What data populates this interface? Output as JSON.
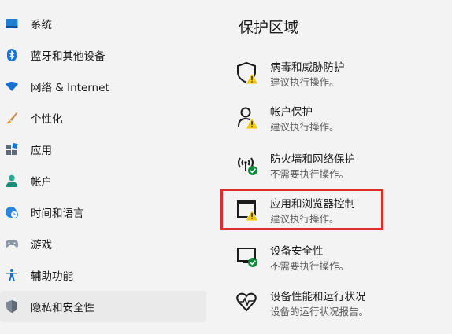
{
  "sidebar": {
    "items": [
      {
        "label": "系统",
        "icon": "system-icon"
      },
      {
        "label": "蓝牙和其他设备",
        "icon": "bluetooth-icon"
      },
      {
        "label": "网络 & Internet",
        "icon": "wifi-icon"
      },
      {
        "label": "个性化",
        "icon": "brush-icon"
      },
      {
        "label": "应用",
        "icon": "apps-icon"
      },
      {
        "label": "帐户",
        "icon": "account-icon"
      },
      {
        "label": "时间和语言",
        "icon": "globe-clock-icon"
      },
      {
        "label": "游戏",
        "icon": "gamepad-icon"
      },
      {
        "label": "辅助功能",
        "icon": "accessibility-icon"
      },
      {
        "label": "隐私和安全性",
        "icon": "shield-icon",
        "selected": true
      }
    ]
  },
  "main": {
    "title": "保护区域",
    "areas": [
      {
        "title": "病毒和威胁防护",
        "status": "建议执行操作。",
        "icon": "virus-protection-icon",
        "state": "warning"
      },
      {
        "title": "帐户保护",
        "status": "建议执行操作。",
        "icon": "account-protection-icon",
        "state": "warning"
      },
      {
        "title": "防火墙和网络保护",
        "status": "不需要执行操作。",
        "icon": "firewall-icon",
        "state": "ok"
      },
      {
        "title": "应用和浏览器控制",
        "status": "建议执行操作。",
        "icon": "app-browser-control-icon",
        "state": "warning"
      },
      {
        "title": "设备安全性",
        "status": "不需要执行操作。",
        "icon": "device-security-icon",
        "state": "ok"
      },
      {
        "title": "设备性能和运行状况",
        "status": "设备的运行状况报告。",
        "icon": "device-health-icon",
        "state": "none"
      }
    ]
  },
  "colors": {
    "warning": "#f2c811",
    "ok": "#0f8a3c",
    "highlight": "#e02b2b",
    "accent": "#0067c0"
  }
}
